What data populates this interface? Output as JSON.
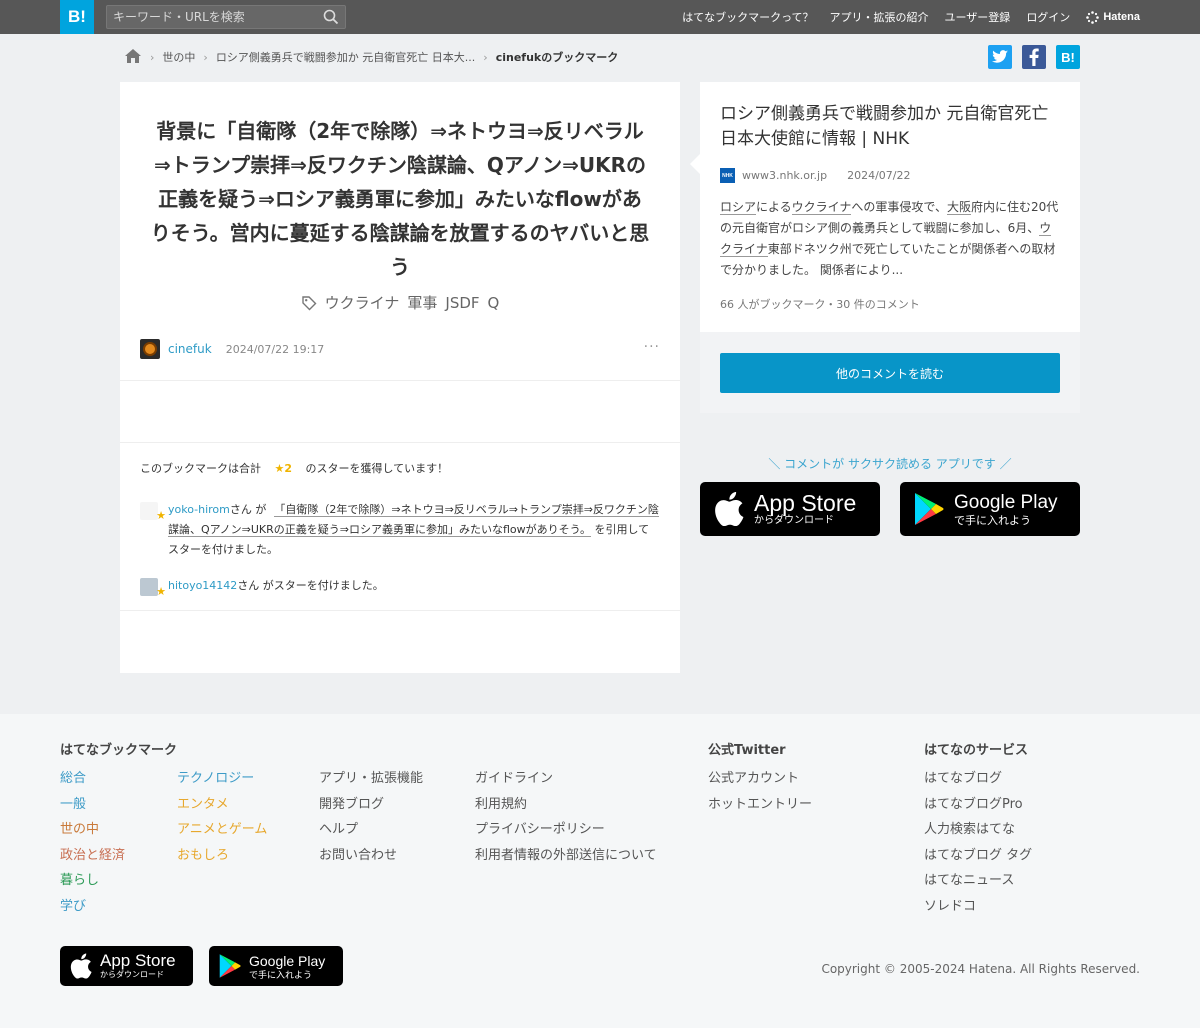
{
  "header": {
    "logo": "B!",
    "search_placeholder": "キーワード・URLを検索",
    "nav": [
      "はてなブックマークって？",
      "アプリ・拡張の紹介",
      "ユーザー登録",
      "ログイン"
    ],
    "brand": "Hatena"
  },
  "breadcrumb": {
    "items": [
      "世の中",
      "ロシア側義勇兵で戦闘参加か 元自衛官死亡 日本大..."
    ],
    "current": "cinefukのブックマーク"
  },
  "share": {
    "hatena": "B!"
  },
  "bookmark": {
    "comment": "背景に「自衛隊（2年で除隊）⇒ネトウヨ⇒反リベラル⇒トランプ崇拝⇒反ワクチン陰謀論、Qアノン⇒UKRの正義を疑う⇒ロシア義勇軍に参加」みたいなflowがありそう。営内に蔓延する陰謀論を放置するのヤバいと思う",
    "tags": [
      "ウクライナ",
      "軍事",
      "JSDF",
      "Q"
    ],
    "user": "cinefuk",
    "date": "2024/07/22 19:17",
    "more": "···"
  },
  "stars": {
    "summary_prefix": "このブックマークは合計",
    "count": "★2",
    "summary_suffix": "のスターを獲得しています！",
    "entries": [
      {
        "user": "yoko-hirom",
        "san_ga": "さん が",
        "quote": "「自衛隊（2年で除隊）⇒ネトウヨ⇒反リベラル⇒トランプ崇拝⇒反ワクチン陰謀論、Qアノン⇒UKRの正義を疑う⇒ロシア義勇軍に参加」みたいなflowがありそう。",
        "suffix": "を引用してスターを付けました。"
      },
      {
        "user": "hitoyo14142",
        "suffix": "さん がスターを付けました。"
      }
    ]
  },
  "entry": {
    "title": "ロシア側義勇兵で戦闘参加か 元自衛官死亡 日本大使館に情報 | NHK",
    "site": "www3.nhk.or.jp",
    "site_icon": "NHK",
    "date": "2024/07/22",
    "summary_parts": [
      "ロシア",
      "による",
      "ウクライナ",
      "への軍事侵攻で、",
      "大阪",
      "府内に住む20代の元自衛官がロシア側の義勇兵として戦闘に参加し、6月、",
      "ウクライナ",
      "東部ドネツク州で死亡していたことが関係者への取材で分かりました。 関係者により..."
    ],
    "count": "66 人がブックマーク・30 件のコメント",
    "read_button": "他のコメントを読む"
  },
  "promo": {
    "text": "＼ コメントが サクサク読める アプリです ／",
    "app_store_big": "App Store",
    "app_store_small": "からダウンロード",
    "google_play_big": "Google Play",
    "google_play_small": "で手に入れよう"
  },
  "footer": {
    "bookmark_heading": "はてなブックマーク",
    "categories_col1": [
      "総合",
      "一般",
      "世の中",
      "政治と経済",
      "暮らし",
      "学び"
    ],
    "categories_col2": [
      "テクノロジー",
      "エンタメ",
      "アニメとゲーム",
      "おもしろ"
    ],
    "links_col3": [
      "アプリ・拡張機能",
      "開発ブログ",
      "ヘルプ",
      "お問い合わせ"
    ],
    "links_col4": [
      "ガイドライン",
      "利用規約",
      "プライバシーポリシー",
      "利用者情報の外部送信について"
    ],
    "twitter_heading": "公式Twitter",
    "twitter_links": [
      "公式アカウント",
      "ホットエントリー"
    ],
    "services_heading": "はてなのサービス",
    "services": [
      "はてなブログ",
      "はてなブログPro",
      "人力検索はてな",
      "はてなブログ タグ",
      "はてなニュース",
      "ソレドコ"
    ],
    "copyright": "Copyright © 2005-2024 Hatena. All Rights Reserved."
  },
  "colors": {
    "header_bg": "#575757",
    "accent": "#00a4de",
    "button": "#0895c8",
    "star": "#f0b400"
  }
}
